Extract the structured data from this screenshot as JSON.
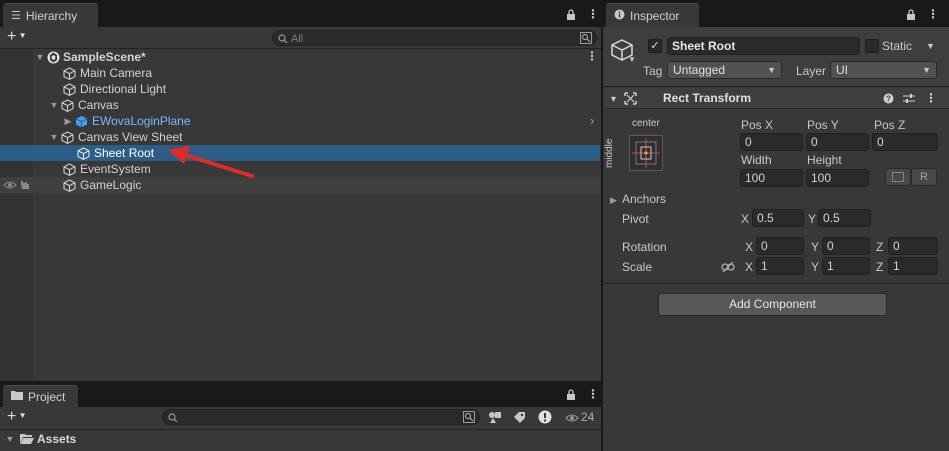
{
  "hierarchy": {
    "tab_label": "Hierarchy",
    "add_label": "+",
    "search_placeholder": "All",
    "items": [
      {
        "label": "SampleScene*"
      },
      {
        "label": "Main Camera"
      },
      {
        "label": "Directional Light"
      },
      {
        "label": "Canvas"
      },
      {
        "label": "EWovaLoginPlane"
      },
      {
        "label": "Canvas View Sheet"
      },
      {
        "label": "Sheet Root"
      },
      {
        "label": "EventSystem"
      },
      {
        "label": "GameLogic"
      }
    ]
  },
  "project": {
    "tab_label": "Project",
    "add_label": "+",
    "hidden_count": "24",
    "assets_label": "Assets"
  },
  "inspector": {
    "tab_label": "Inspector",
    "object_name": "Sheet Root",
    "static_label": "Static",
    "tag_label": "Tag",
    "tag_value": "Untagged",
    "layer_label": "Layer",
    "layer_value": "UI",
    "component_title": "Rect Transform",
    "anchor_h": "center",
    "anchor_v": "middle",
    "pos_x_label": "Pos X",
    "pos_y_label": "Pos Y",
    "pos_z_label": "Pos Z",
    "pos_x": "0",
    "pos_y": "0",
    "pos_z": "0",
    "width_label": "Width",
    "height_label": "Height",
    "width": "100",
    "height": "100",
    "r_label": "R",
    "anchors_label": "Anchors",
    "pivot_label": "Pivot",
    "pivot_x_label": "X",
    "pivot_y_label": "Y",
    "pivot_x": "0.5",
    "pivot_y": "0.5",
    "rotation_label": "Rotation",
    "rot_x": "0",
    "rot_y": "0",
    "rot_z": "0",
    "scale_label": "Scale",
    "scale_x": "1",
    "scale_y": "1",
    "scale_z": "1",
    "x_label": "X",
    "y_label": "Y",
    "z_label": "Z",
    "add_component_label": "Add Component"
  },
  "colors": {
    "selection": "#2c5d87",
    "prefab_blue": "#7ab9ff",
    "annotation_arrow": "#e02b2b"
  }
}
